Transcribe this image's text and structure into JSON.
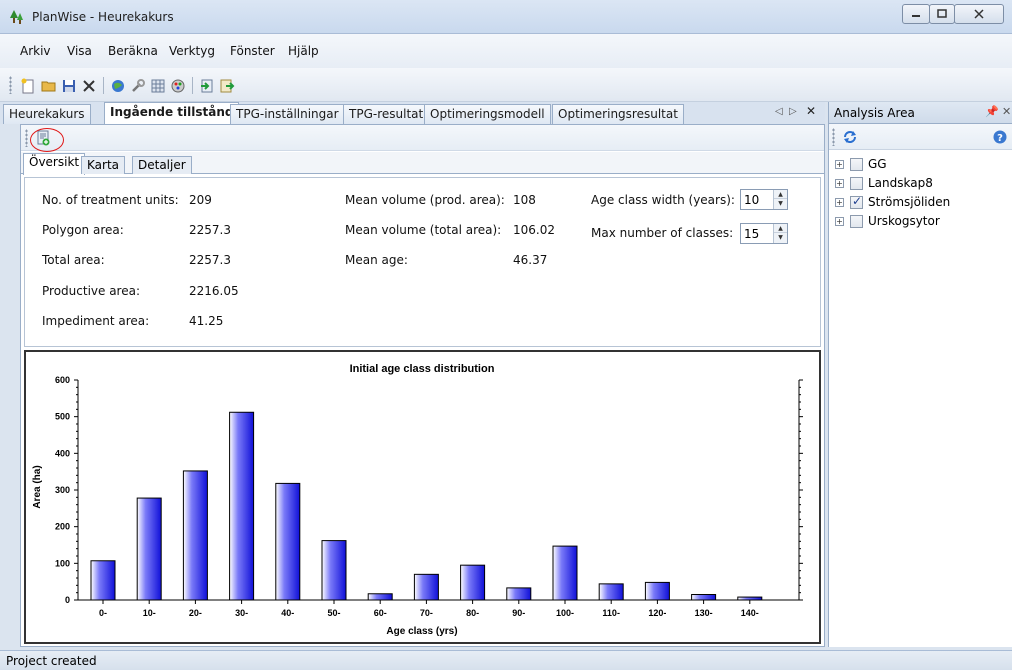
{
  "window": {
    "title": "PlanWise - Heurekakurs"
  },
  "menu": [
    "Arkiv",
    "Visa",
    "Beräkna",
    "Verktyg",
    "Fönster",
    "Hjälp"
  ],
  "toolbar": {
    "icons": [
      "new-file-icon",
      "open-folder-icon",
      "save-icon",
      "delete-icon",
      "globe-icon",
      "tools-icon",
      "grid-settings-icon",
      "palette-icon",
      "import-icon",
      "export-icon"
    ]
  },
  "doc_tabs": [
    "Heurekakurs",
    "Ingående tillstånd",
    "TPG-inställningar",
    "TPG-resultat",
    "Optimeringsmodell",
    "Optimeringsresultat"
  ],
  "active_doc_tab": "Ingående tillstånd",
  "sub_tabs": [
    "Översikt",
    "Karta",
    "Detaljer"
  ],
  "stats": {
    "col1": [
      {
        "label": "No. of treatment units:",
        "value": "209"
      },
      {
        "label": "Polygon area:",
        "value": "2257.3"
      },
      {
        "label": "Total area:",
        "value": "2257.3"
      },
      {
        "label": "Productive area:",
        "value": "2216.05"
      },
      {
        "label": "Impediment area:",
        "value": "41.25"
      }
    ],
    "col2": [
      {
        "label": "Mean volume (prod. area):",
        "value": "108"
      },
      {
        "label": "Mean volume (total area):",
        "value": "106.02"
      },
      {
        "label": "Mean age:",
        "value": "46.37"
      }
    ],
    "col3": [
      {
        "label": "Age class width (years):",
        "value": "10"
      },
      {
        "label": "Max number of classes:",
        "value": "15"
      }
    ]
  },
  "chart_data": {
    "type": "bar",
    "title": "Initial age class distribution",
    "xlabel": "Age class (yrs)",
    "ylabel": "Area (ha)",
    "categories": [
      "0-",
      "10-",
      "20-",
      "30-",
      "40-",
      "50-",
      "60-",
      "70-",
      "80-",
      "90-",
      "100-",
      "110-",
      "120-",
      "130-",
      "140-"
    ],
    "values": [
      107,
      278,
      352,
      512,
      318,
      162,
      17,
      70,
      95,
      33,
      147,
      44,
      48,
      15,
      8
    ],
    "ylim": [
      0,
      600
    ],
    "yticks": [
      "0",
      "100",
      "200",
      "300",
      "400",
      "500",
      "600"
    ],
    "bar_color": "#2222ee"
  },
  "right_pane": {
    "title": "Analysis Area",
    "items": [
      {
        "label": "GG",
        "checked": false
      },
      {
        "label": "Landskap8",
        "checked": false
      },
      {
        "label": "Strömsjöliden",
        "checked": true
      },
      {
        "label": "Urskogsytor",
        "checked": false
      }
    ]
  },
  "status": "Project created"
}
